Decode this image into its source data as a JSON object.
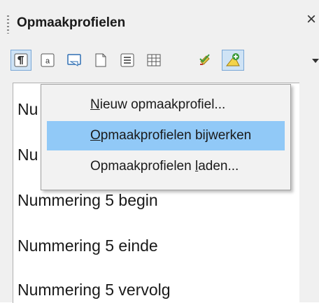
{
  "panel": {
    "title": "Opmaakprofielen",
    "close_glyph": "×"
  },
  "toolbar": {
    "buttons": [
      {
        "icon": "paragraph-styles-icon",
        "active": true
      },
      {
        "icon": "character-styles-icon"
      },
      {
        "icon": "frame-styles-icon"
      },
      {
        "icon": "page-styles-icon"
      },
      {
        "icon": "list-styles-icon"
      },
      {
        "icon": "table-styles-icon"
      },
      {
        "icon": "fill-format-mode-icon"
      },
      {
        "icon": "styles-actions-icon"
      }
    ]
  },
  "list": {
    "items": [
      "Nu",
      "Nu",
      "Nummering 5 begin",
      "Nummering 5 einde",
      "Nummering 5 vervolg"
    ]
  },
  "menu": {
    "items": [
      {
        "prefix": "",
        "accel": "N",
        "rest": "ieuw opmaakprofiel...",
        "highlighted": false
      },
      {
        "prefix": "",
        "accel": "O",
        "rest": "pmaakprofielen bijwerken",
        "highlighted": true
      },
      {
        "prefix": "Opmaakprofielen ",
        "accel": "l",
        "rest": "aden...",
        "highlighted": false
      }
    ]
  },
  "colors": {
    "menu_highlight": "#91c9f7",
    "panel_bg": "#f0f0f0"
  }
}
